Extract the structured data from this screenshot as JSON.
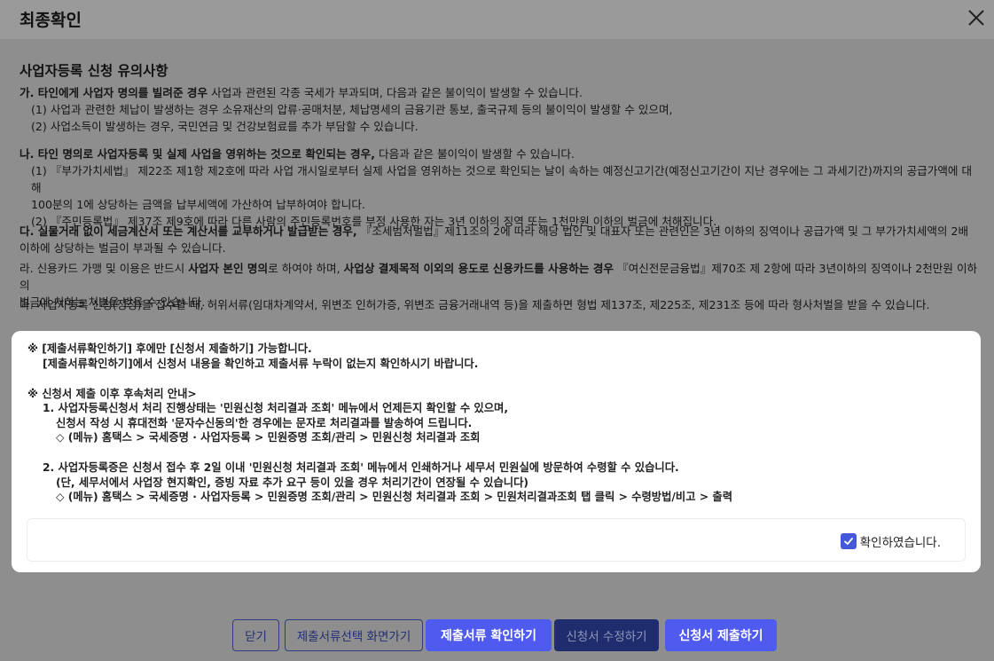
{
  "dialog": {
    "title": "최종확인"
  },
  "notice": {
    "title": "사업자등록 신청 유의사항",
    "ga": {
      "prefix": "가. ",
      "bold": "타인에게 사업자 명의를 빌려준 경우",
      "rest": " 사업과 관련된 각종 국세가 부과되며, 다음과 같은 불이익이 발생할 수 있습니다.",
      "items": [
        "(1) 사업과 관련한 체납이 발생하는 경우 소유재산의 압류·공매처분, 체납명세의 금융기관 통보, 출국규제 등의 불이익이 발생할 수 있으며,",
        "(2) 사업소득이 발생하는 경우, 국민연금 및 건강보험료를 추가 부담할 수 있습니다."
      ]
    },
    "na": {
      "prefix": "나. ",
      "bold": "타인 명의로 사업자등록 및 실제 사업을 영위하는 것으로 확인되는 경우,",
      "rest": " 다음과 같은 불이익이 발생할 수 있습니다.",
      "items": [
        "(1) 『부가가치세법』 제22조 제1항 제2호에 따라 사업 개시일로부터 실제 사업을 영위하는 것으로 확인되는 날이 속하는 예정신고기간(예정신고기간이 지난 경우에는 그 과세기간)까지의 공급가액에 대해",
        "100분의 1에 상당하는 금액을 납부세액에 가산하여 납부하여야 합니다.",
        "(2) 『주민등록법』 제37조 제9호에 따라 다른 사람의 주민등록번호를 부정 사용한 자는 3년 이하의 징역 또는 1천만원 이하의 벌금에 처해집니다."
      ]
    },
    "da": {
      "prefix": "다. ",
      "bold": "실물거래 없이 세금계산서 또는 계산서를 교부하거나 발급받는 경우,",
      "rest": " 『조세범처벌법』제11조의 2에 따라 해당 법인 및 대표자 또는 관련인은 3년 이하의 징역이나 공급가액 및 그 부가가치세액의 2배",
      "line2": "이하에 상당하는 벌금이 부과될 수 있습니다."
    },
    "ra": {
      "prefix": "라. 신용카드 가맹 및 이용은 반드시 ",
      "bold1": "사업자 본인 명의",
      "mid": "로 하여야 하며, ",
      "bold2": "사업상 결제목적 이외의 용도로 신용카드를 사용하는 경우",
      "rest": " 『여신전문금융법』제70조 제 2항에 따라 3년이하의 징역이나 2천만원 이하의",
      "line2": "벌금에 처하는 처벌을 받을 수 있습니다."
    },
    "ma": {
      "text": "마. 사업자등록 신청(정정)을 접수할 때, 허위서류(임대차계약서, 위변조 인허가증, 위변조 금융거래내역 등)을 제출하면 형법 제137조, 제225조, 제231조 등에 따라 형사처벌을 받을 수 있습니다."
    }
  },
  "confirm": {
    "line1": "※ [제출서류확인하기] 후에만 [신청서 제출하기] 가능합니다.",
    "line2": "[제출서류확인하기]에서 신청서 내용을 확인하고 제출서류 누락이 없는지 확인하시기 바랍니다.",
    "line3": "※ 신청서 제출 이후 후속처리 안내>",
    "item1_a": "1.  사업자등록신청서 처리 진행상태는 '민원신청 처리결과 조회' 메뉴에서 언제든지 확인할 수 있으며,",
    "item1_b": "신청서 작성 시 휴대전화 '문자수신동의'한 경우에는 문자로 처리결과를 발송하여 드립니다.",
    "item1_c": "◇ (메뉴) 홈택스 > 국세증명 · 사업자등록 > 민원증명 조회/관리 > 민원신청 처리결과 조회",
    "item2_a": "2.  사업자등록증은 신청서 접수 후 2일 이내 '민원신청 처리결과 조회' 메뉴에서 인쇄하거나 세무서 민원실에 방문하여 수령할 수 있습니다.",
    "item2_b": "(단, 세무서에서 사업장 현지확인, 증빙 자료 추가 요구 등이 있을 경우 처리기간이 연장될 수 있습니다)",
    "item2_c": "◇ (메뉴) 홈택스 > 국세증명 · 사업자등록 > 민원증명 조회/관리 > 민원신청 처리결과 조회 > 민원처리결과조회 탭 클릭 > 수령방법/비고 > 출력",
    "checkbox_label": "확인하였습니다.",
    "checkbox_checked": true
  },
  "footer": {
    "close": "닫기",
    "go_select": "제출서류선택 화면가기",
    "check_docs": "제출서류 확인하기",
    "modify": "신청서 수정하기",
    "submit": "신청서 제출하기"
  },
  "colors": {
    "primary": "#4f5bef",
    "dim": "#1f2d6e",
    "checkbox": "#4459d9"
  }
}
